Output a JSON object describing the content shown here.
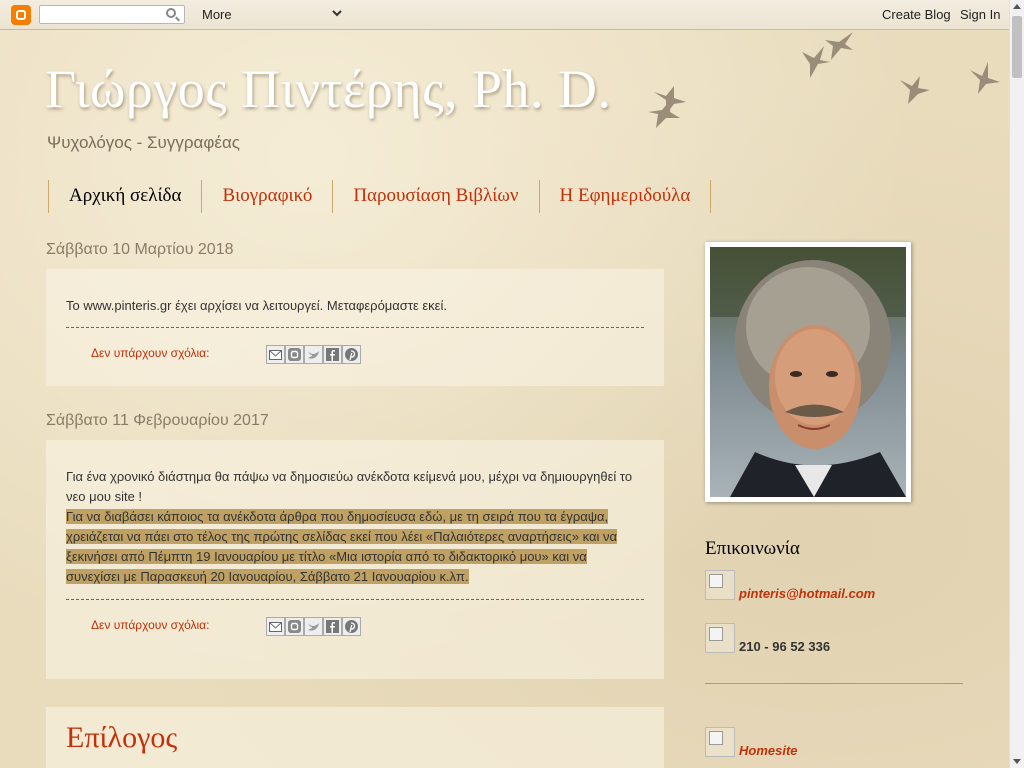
{
  "navbar": {
    "search_placeholder": "",
    "more_label": "More",
    "create_blog_label": "Create Blog",
    "sign_in_label": "Sign In"
  },
  "header": {
    "title": "Γιώργος Πιντέρης, Ph. D.",
    "description": "Ψυχολόγος - Συγγραφέας"
  },
  "tabs": [
    {
      "label": "Αρχική σελίδα",
      "active": true
    },
    {
      "label": "Βιογραφικό",
      "active": false
    },
    {
      "label": "Παρουσίαση Βιβλίων",
      "active": false
    },
    {
      "label": "Η Εφημεριδούλα",
      "active": false
    }
  ],
  "posts": [
    {
      "date": "Σάββατο 10 Μαρτίου 2018",
      "body": "Το www.pinteris.gr έχει αρχίσει να λειτουργεί. Μεταφερόμαστε εκεί.",
      "comments": "Δεν υπάρχουν σχόλια:"
    },
    {
      "date": "Σάββατο 11 Φεβρουαρίου 2017",
      "body_intro": "Για ένα χρονικό διάστημα θα πάψω να δημοσιεύω ανέκδοτα κείμενά μου, μέχρι να δημιουργηθεί το νεο μου site !",
      "body_highlight": "Για να διαβάσει κάποιος τα ανέκδοτα άρθρα που δημοσίευσα εδώ,  με τη σειρά που τα έγραψα, χρειάζεται να πάει στο τέλος της πρώτης σελίδας εκεί που λέει «Παλαιότερες αναρτήσεις» και να ξεκινήσει από Πέμπτη 19 Ιανουαρίου με τίτλο «Μια ιστορία από το διδακτορικό μου» και να συνεχίσει με Παρασκευή 20 Ιανουαρίου, Σάββατο 21 Ιανουαρίου κ.λπ.",
      "comments": "Δεν υπάρχουν σχόλια:"
    },
    {
      "title": "Επίλογος"
    }
  ],
  "share_buttons": [
    "email-icon",
    "blogthis-icon",
    "twitter-icon",
    "facebook-icon",
    "pinterest-icon"
  ],
  "sidebar": {
    "contact_title": "Επικοινωνία",
    "email": "pinteris@hotmail.com",
    "phone": "210 - 96 52 336",
    "homesite": "Homesite"
  },
  "colors": {
    "link": "#c1310a",
    "highlight": "#c0a164",
    "background": "#e9dcbd"
  }
}
